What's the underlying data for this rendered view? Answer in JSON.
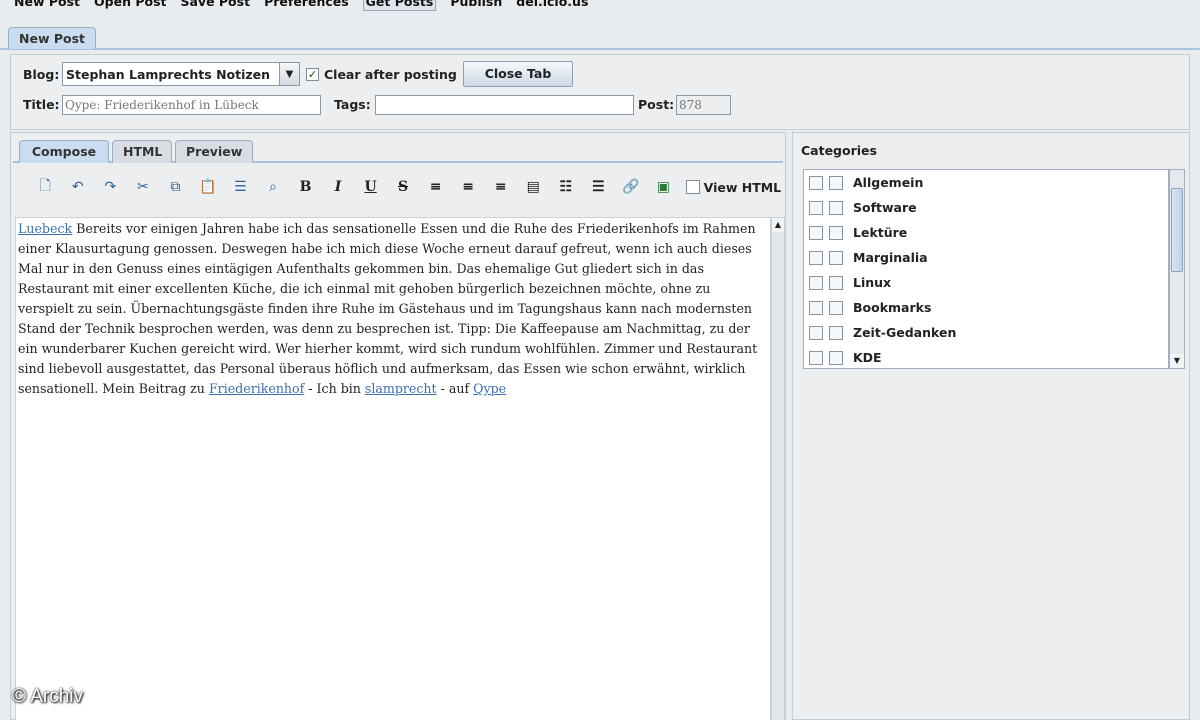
{
  "menu": [
    "New Post",
    "Open Post",
    "Save Post",
    "Preferences",
    "Get Posts",
    "Publish",
    "del.icio.us"
  ],
  "outer_tab": "New Post",
  "form": {
    "blog_label": "Blog:",
    "blog_value": "Stephan Lamprechts Notizen",
    "clear_label": "Clear after posting",
    "close_tab": "Close Tab",
    "title_label": "Title:",
    "title_value": "Qype: Friederikenhof in Lübeck",
    "tags_label": "Tags:",
    "tags_value": "",
    "post_label": "Post:",
    "post_value": "878"
  },
  "editor_tabs": [
    "Compose",
    "HTML",
    "Preview"
  ],
  "toolbar": {
    "view_html": "View HTML"
  },
  "body": {
    "link1": "Luebeck",
    "text1": " Bereits vor einigen Jahren habe ich das sensationelle Essen und die Ruhe des Friederikenhofs im Rahmen einer Klausurtagung genossen. Deswegen habe ich mich diese Woche erneut darauf gefreut, wenn ich auch dieses Mal nur in den Genuss eines eintägigen Aufenthalts gekommen bin. Das ehemalige Gut gliedert sich in das Restaurant mit einer excellenten Küche, die ich einmal mit gehoben bürgerlich bezeichnen möchte, ohne zu verspielt zu sein. Übernachtungsgäste finden ihre Ruhe im Gästehaus und im Tagungshaus kann nach modernsten Stand der Technik besprochen werden, was denn zu besprechen ist. Tipp: Die Kaffeepause am Nachmittag, zu der ein wunderbarer Kuchen gereicht wird. Wer hierher kommt, wird sich rundum wohlfühlen. Zimmer und Restaurant sind liebevoll ausgestattet, das Personal überaus höflich und aufmerksam, das Essen wie schon erwähnt, wirklich sensationell. Mein Beitrag zu ",
    "link2": "Friederikenhof",
    "text2": " - Ich bin ",
    "link3": "slamprecht",
    "text3": " - auf ",
    "link4": "Qype"
  },
  "categories_title": "Categories",
  "categories": [
    "Allgemein",
    "Software",
    "Lektüre",
    "Marginalia",
    "Linux",
    "Bookmarks",
    "Zeit-Gedanken",
    "KDE"
  ],
  "watermark": "© Archiv"
}
